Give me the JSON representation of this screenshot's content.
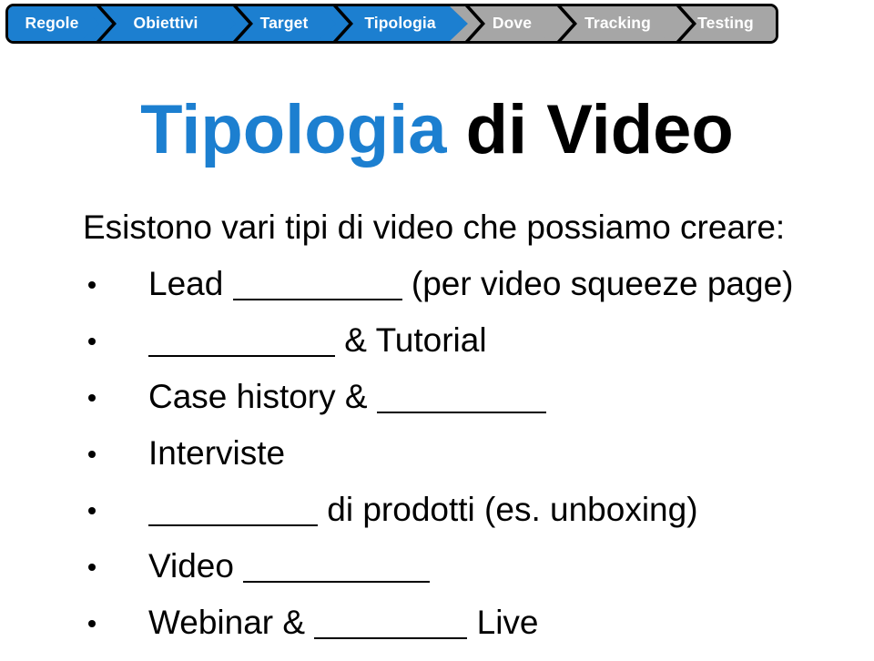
{
  "slide": {
    "background_color": "#ffffff",
    "accent_color": "#1c7fd0",
    "inactive_color": "#a6a6a6",
    "text_color": "#000000"
  },
  "process_nav": {
    "name": "process-chevron-bar",
    "steps": [
      {
        "label": "Regole",
        "state": "completed",
        "color": "#1c7fd0"
      },
      {
        "label": "Obiettivi",
        "state": "completed",
        "color": "#1c7fd0"
      },
      {
        "label": "Target",
        "state": "completed",
        "color": "#1c7fd0"
      },
      {
        "label": "Tipologia",
        "state": "current",
        "color": "#1c7fd0"
      },
      {
        "label": "Dove",
        "state": "upcoming",
        "color": "#a6a6a6"
      },
      {
        "label": "Tracking",
        "state": "upcoming",
        "color": "#a6a6a6"
      },
      {
        "label": "Testing",
        "state": "upcoming",
        "color": "#a6a6a6"
      }
    ]
  },
  "title": {
    "accent_part": "Tipologia",
    "plain_part": " di Video",
    "full": "Tipologia di Video"
  },
  "content": {
    "intro": "Esistono vari tipi di video che possiamo creare:",
    "bullets": [
      {
        "before": "Lead ",
        "blank": "___________",
        "after": " (per video squeeze page)"
      },
      {
        "before": "",
        "blank": "____________",
        "after": " & Tutorial"
      },
      {
        "before": "Case history & ",
        "blank": "___________",
        "after": ""
      },
      {
        "before": "Interviste",
        "blank": "",
        "after": ""
      },
      {
        "before": "",
        "blank": "___________",
        "after": " di prodotti (es. unboxing)"
      },
      {
        "before": "Video ",
        "blank": "_____________",
        "after": ""
      },
      {
        "before": "Webinar & ",
        "blank": "___________",
        "after": " Live"
      }
    ]
  }
}
